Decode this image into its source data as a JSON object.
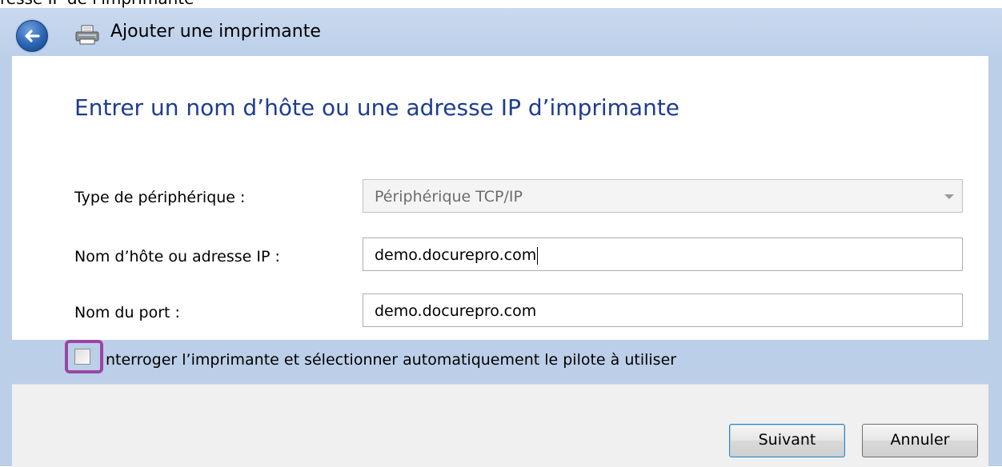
{
  "caption": "ressé IP de l'imprimante",
  "window": {
    "title": "Ajouter une imprimante"
  },
  "page": {
    "heading": "Entrer un nom d’hôte ou une adresse IP d’imprimante"
  },
  "form": {
    "device_type": {
      "label": "Type de périphérique :",
      "value": "Périphérique TCP/IP"
    },
    "hostname": {
      "label": "Nom d’hôte ou adresse IP :",
      "value": "demo.docurepro.com"
    },
    "port_name": {
      "label": "Nom du port :",
      "value": "demo.docurepro.com"
    },
    "query_printer": {
      "label": "nterroger l’imprimante et sélectionner automatiquement le pilote à utiliser",
      "checked": false
    }
  },
  "buttons": {
    "next": "Suivant",
    "cancel": "Annuler"
  },
  "colors": {
    "heading": "#1e3d8f",
    "frame": "#bccfe8",
    "highlight": "#9b45a5"
  },
  "icons": {
    "back": "back-arrow-icon",
    "printer": "printer-icon"
  }
}
